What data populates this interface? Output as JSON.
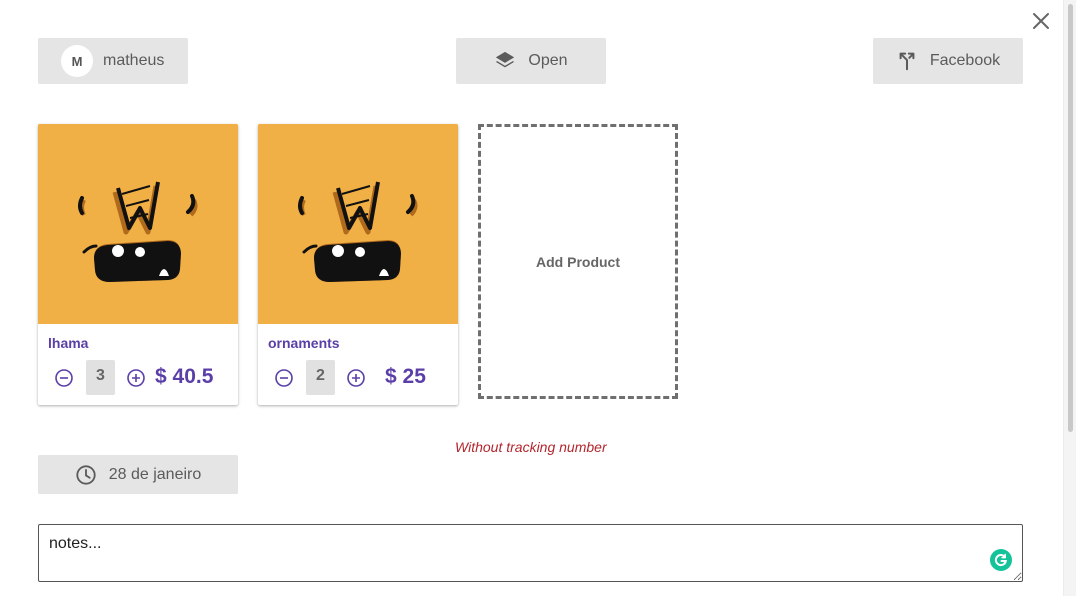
{
  "header": {
    "user": {
      "avatar_initial": "M",
      "name": "matheus"
    },
    "status": {
      "label": "Open"
    },
    "source": {
      "label": "Facebook"
    }
  },
  "products": [
    {
      "name": "lhama",
      "quantity": "3",
      "price": "$ 40.5"
    },
    {
      "name": "ornaments",
      "quantity": "2",
      "price": "$ 25"
    }
  ],
  "add_product_label": "Add Product",
  "tracking_message": "Without tracking number",
  "date": {
    "label": "28 de janeiro"
  },
  "notes": {
    "placeholder": "notes..."
  },
  "colors": {
    "accent": "#5b3fa8",
    "chip_bg": "#e6e5e5",
    "product_bg": "#f1b046",
    "error": "#b3262d",
    "grammarly": "#15c39a"
  },
  "icons": [
    "close-icon",
    "layers-icon",
    "call-split-icon",
    "clock-icon",
    "minus-circle-icon",
    "plus-circle-icon",
    "grammarly-icon"
  ]
}
